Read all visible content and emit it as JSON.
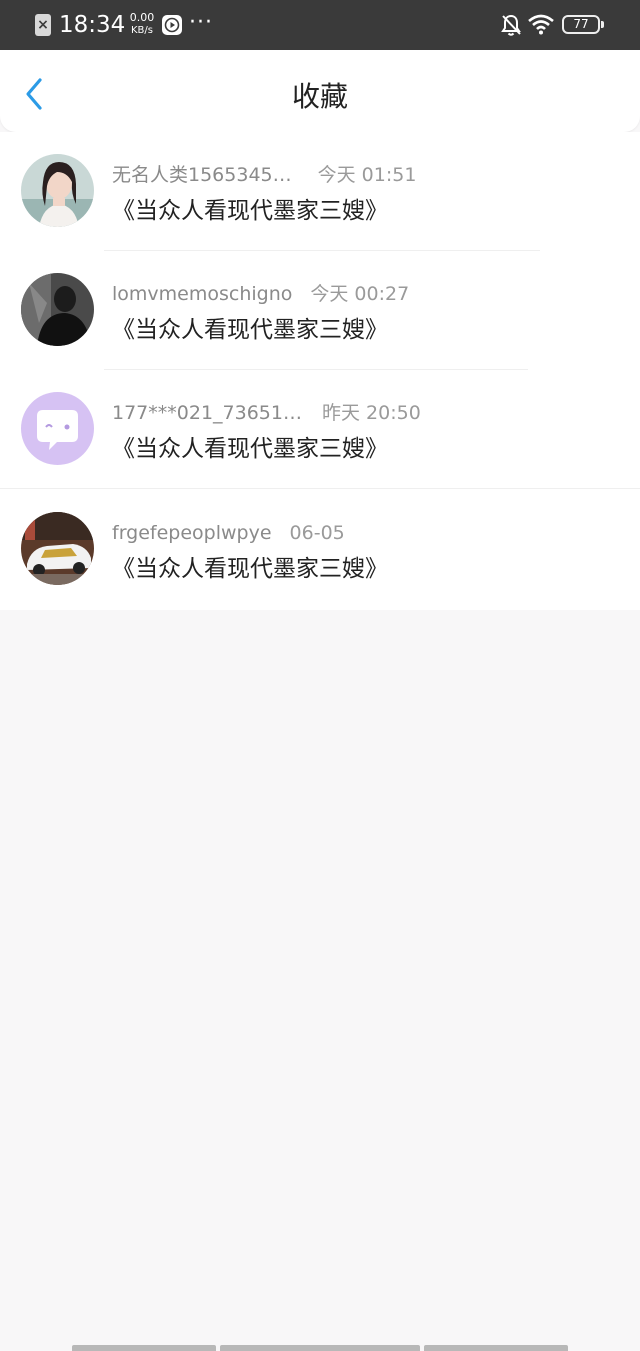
{
  "status_bar": {
    "time": "18:34",
    "speed_value": "0.00",
    "speed_unit": "KB/s",
    "dots": "···",
    "battery": "77",
    "icons": [
      "app-close-icon",
      "play-icon",
      "bell-off-icon",
      "wifi-icon",
      "battery-icon"
    ]
  },
  "nav": {
    "title": "收藏",
    "back_icon": "chevron-left-icon",
    "accent": "#2c9be6"
  },
  "favorites": [
    {
      "user": "无名人类1565345…",
      "time": "今天 01:51",
      "title": "《当众人看现代墨家三嫂》"
    },
    {
      "user": "lomvmemoschigno",
      "time": "今天 00:27",
      "title": "《当众人看现代墨家三嫂》"
    },
    {
      "user": "177***021_73651…",
      "time": "昨天 20:50",
      "title": "《当众人看现代墨家三嫂》"
    },
    {
      "user": "frgefepeoplwpye",
      "time": "06-05",
      "title": "《当众人看现代墨家三嫂》"
    }
  ]
}
